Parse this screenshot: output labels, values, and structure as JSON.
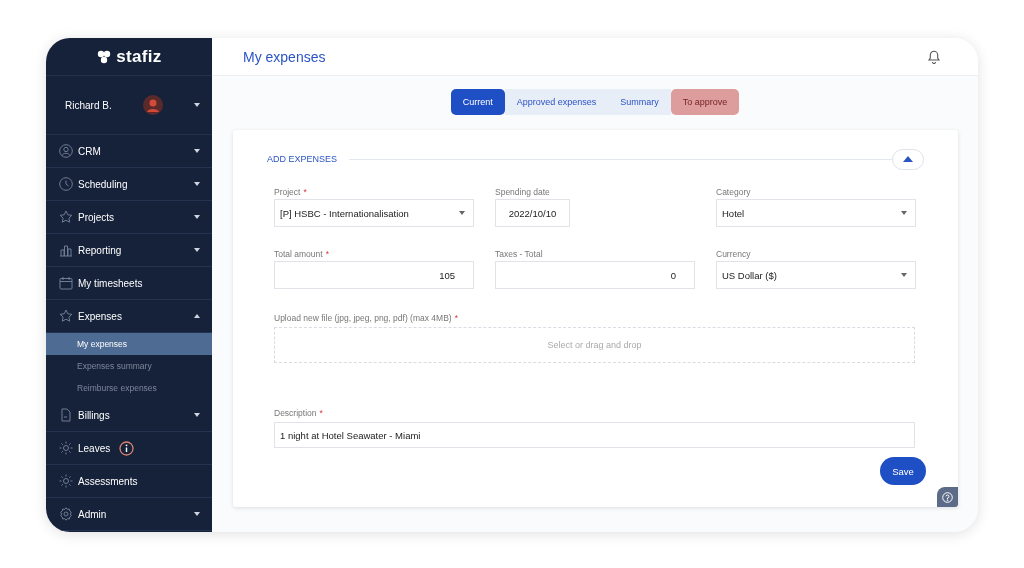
{
  "brand": {
    "name": "stafiz"
  },
  "user": {
    "name": "Richard B."
  },
  "sidebar": {
    "items": [
      {
        "label": "CRM",
        "expanded": false
      },
      {
        "label": "Scheduling",
        "expanded": false
      },
      {
        "label": "Projects",
        "expanded": false
      },
      {
        "label": "Reporting",
        "expanded": false
      },
      {
        "label": "My timesheets"
      },
      {
        "label": "Expenses",
        "expanded": true,
        "children": [
          {
            "label": "My expenses",
            "selected": true
          },
          {
            "label": "Expenses summary",
            "selected": false
          },
          {
            "label": "Reimburse expenses",
            "selected": false
          }
        ]
      },
      {
        "label": "Billings",
        "expanded": false
      },
      {
        "label": "Leaves",
        "info": true
      },
      {
        "label": "Assessments"
      },
      {
        "label": "Admin",
        "expanded": false
      }
    ]
  },
  "page": {
    "title": "My expenses"
  },
  "tabs": [
    {
      "label": "Current",
      "selected": true,
      "kind": "normal"
    },
    {
      "label": "Approved expenses",
      "selected": false,
      "kind": "normal"
    },
    {
      "label": "Summary",
      "selected": false,
      "kind": "normal"
    },
    {
      "label": "To approve",
      "selected": false,
      "kind": "alert"
    }
  ],
  "section": {
    "title": "ADD EXPENSES",
    "expanded": true
  },
  "fields": [
    {
      "label": "Project",
      "mark": "*",
      "kind": "select",
      "value": "[P] HSBC - Internationalisation"
    },
    {
      "label": "Spending date",
      "kind": "date",
      "value": "2022/10/10"
    },
    {
      "label": "Category",
      "kind": "select",
      "value": "Hotel"
    },
    {
      "label": "Total amount",
      "mark": "*",
      "kind": "number",
      "value": "105"
    },
    {
      "label": "Taxes - Total",
      "kind": "number",
      "value": "0"
    },
    {
      "label": "Currency",
      "kind": "select",
      "value": "US Dollar ($)"
    }
  ],
  "upload": {
    "label": "Upload new file (jpg, jpeg, png, pdf) (max 4MB)",
    "mark": "*",
    "placeholder": "Select or drag and drop"
  },
  "description": {
    "label": "Description",
    "mark": "*",
    "value": "1 night at Hotel Seawater - Miami"
  },
  "buttons": {
    "save": "Save"
  }
}
